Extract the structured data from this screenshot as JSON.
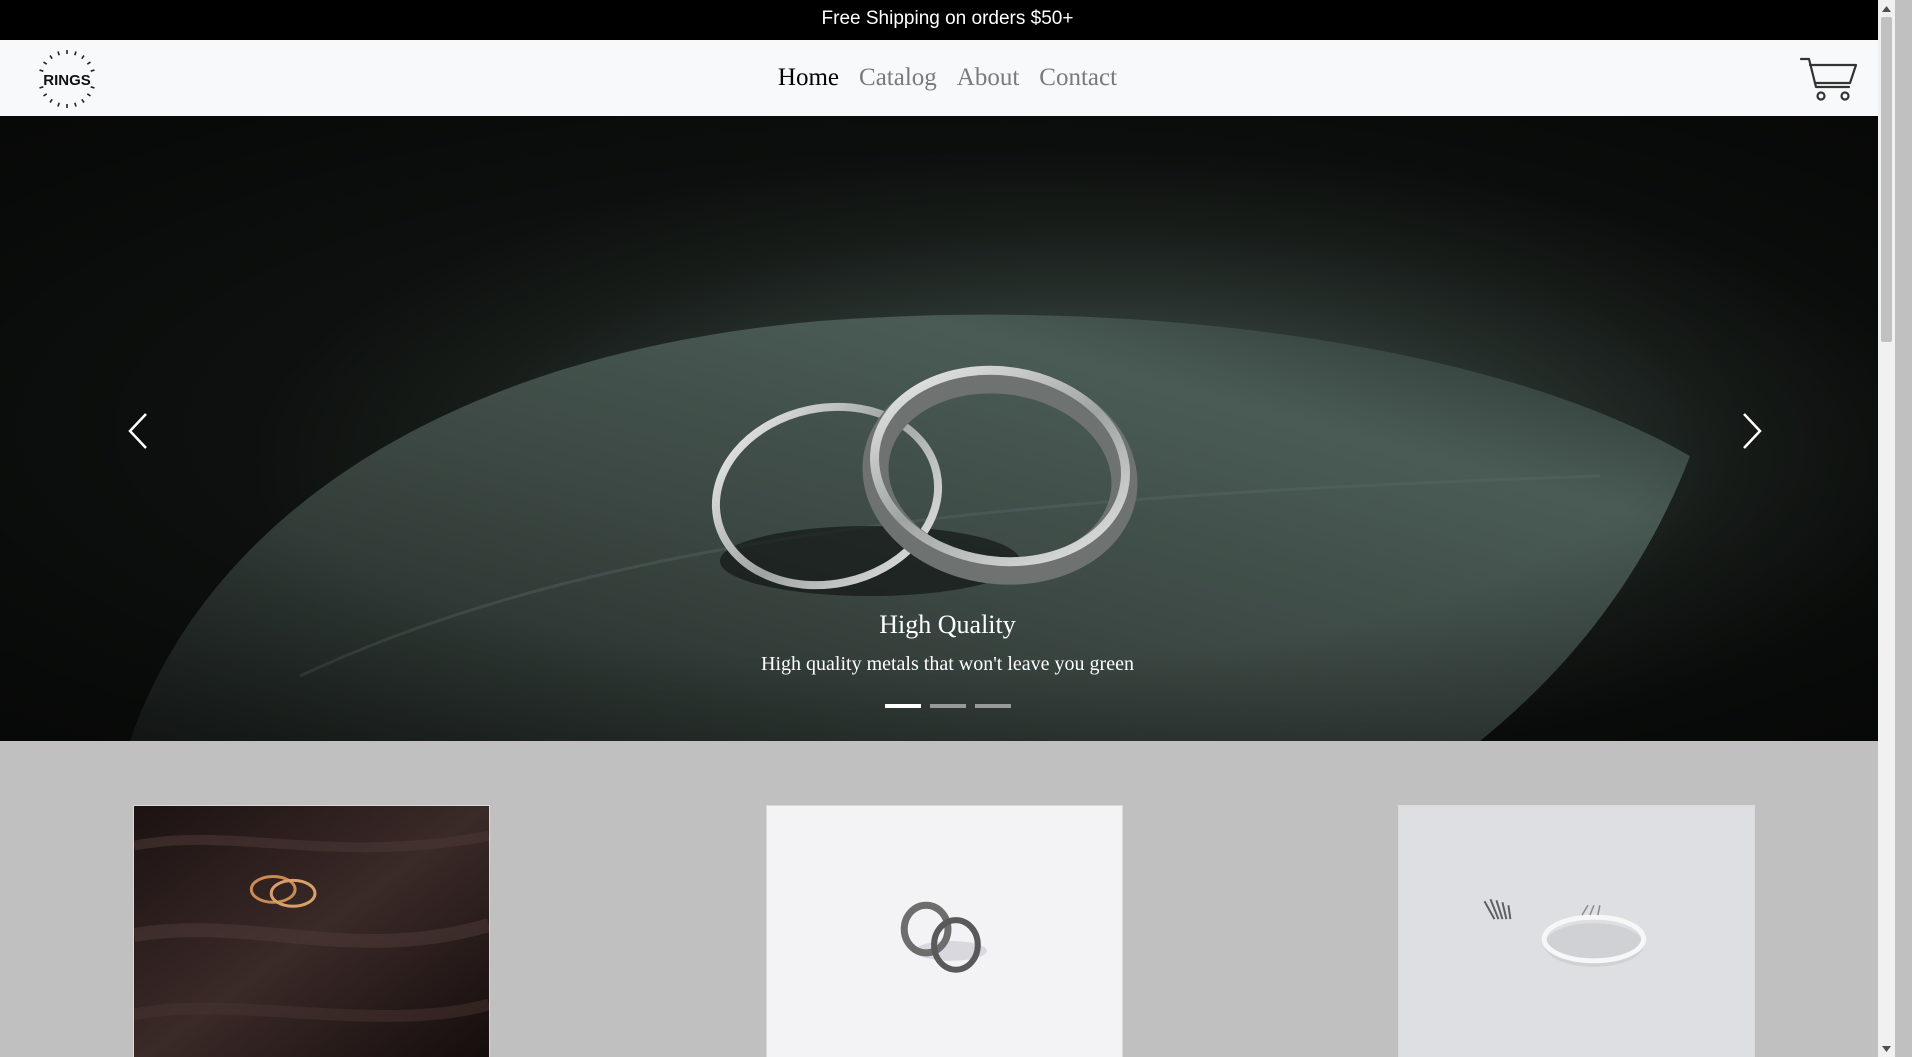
{
  "announcement": {
    "text": "Free Shipping on orders $50+"
  },
  "logo": {
    "text": "RINGS"
  },
  "nav": {
    "links": [
      {
        "label": "Home",
        "active": true
      },
      {
        "label": "Catalog",
        "active": false
      },
      {
        "label": "About",
        "active": false
      },
      {
        "label": "Contact",
        "active": false
      }
    ]
  },
  "cart": {
    "icon": "shopping-cart-icon"
  },
  "carousel": {
    "active_slide": 0,
    "slide_count": 3,
    "caption_title": "High Quality",
    "caption_text": "High quality metals that won't leave you green",
    "prev_icon": "chevron-left-icon",
    "next_icon": "chevron-right-icon"
  },
  "products": {
    "count_visible": 3
  },
  "colors": {
    "announcement_bg": "#000000",
    "navbar_bg": "#f8f9fa",
    "page_bg": "#c0c0c0",
    "nav_active": "#000000",
    "nav_inactive": "#7a7a7a"
  }
}
